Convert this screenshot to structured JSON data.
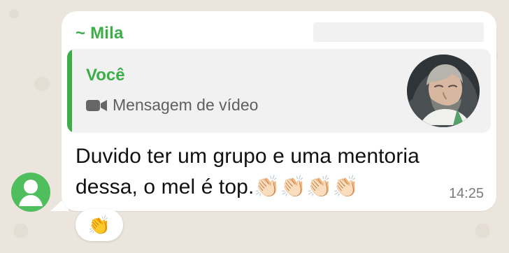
{
  "message": {
    "sender_name": "~ Mila",
    "text": "Duvido ter um grupo e uma mentoria dessa, o mel é top.👏🏻👏🏻👏🏻👏🏻",
    "time": "14:25",
    "reaction": "👏"
  },
  "quoted": {
    "author": "Você",
    "type_label": "Mensagem de vídeo",
    "icon": "video-camera-icon"
  },
  "sender_avatar": {
    "icon": "default-person-avatar-icon",
    "color": "#4fbe5c"
  },
  "colors": {
    "accent": "#3bae48",
    "bubble": "#ffffff",
    "background": "#ece5dd",
    "quote_background": "#f1f1f1"
  }
}
